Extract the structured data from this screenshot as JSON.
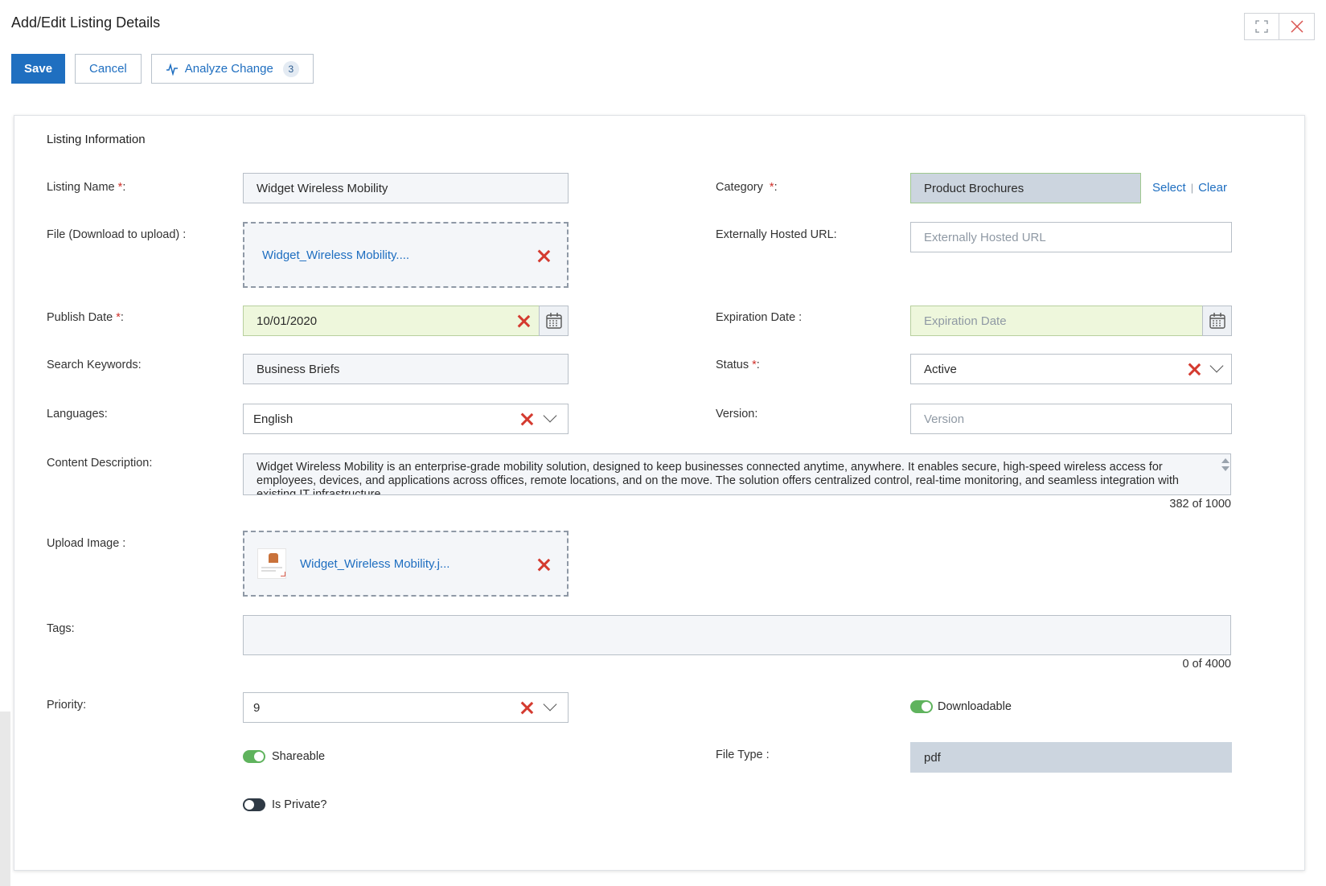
{
  "header": {
    "title": "Add/Edit Listing Details",
    "save_label": "Save",
    "cancel_label": "Cancel",
    "analyze_label": "Analyze Change",
    "analyze_count": "3"
  },
  "section": {
    "title": "Listing Information"
  },
  "fields": {
    "listing_name": {
      "label": "Listing Name",
      "required": "*",
      "suffix": ":",
      "value": "Widget Wireless Mobility"
    },
    "file": {
      "label": "File (Download to upload) :",
      "value": "Widget_Wireless Mobility...."
    },
    "publish_date": {
      "label": "Publish Date",
      "required": "*",
      "suffix": ":",
      "value": "10/01/2020"
    },
    "search_keywords": {
      "label": "Search Keywords:",
      "value": "Business Briefs"
    },
    "languages": {
      "label": "Languages:",
      "value": "English"
    },
    "content_description": {
      "label": "Content Description:",
      "value": "Widget Wireless Mobility is an enterprise-grade mobility solution, designed to keep businesses connected anytime, anywhere. It enables secure, high-speed wireless access for employees, devices, and applications across offices, remote locations, and on the move. The solution offers centralized control, real-time monitoring, and seamless integration with existing IT infrastructure.",
      "counter": "382 of 1000"
    },
    "upload_image": {
      "label": "Upload Image :",
      "value": "Widget_Wireless Mobility.j..."
    },
    "tags": {
      "label": "Tags:",
      "value": "",
      "counter": "0 of 4000"
    },
    "priority": {
      "label": "Priority:",
      "value": "9"
    },
    "category": {
      "label": "Category",
      "required": "*",
      "suffix": ":",
      "value": "Product Brochures",
      "select_label": "Select",
      "sep": "|",
      "clear_label": "Clear"
    },
    "external_url": {
      "label": "Externally Hosted URL:",
      "placeholder": "Externally Hosted URL"
    },
    "expiration_date": {
      "label": "Expiration Date :",
      "placeholder": "Expiration Date"
    },
    "status": {
      "label": "Status",
      "required": "*",
      "suffix": ":",
      "value": "Active"
    },
    "version": {
      "label": "Version:",
      "placeholder": "Version"
    },
    "file_type": {
      "label": "File Type :",
      "value": "pdf"
    }
  },
  "toggles": {
    "downloadable": {
      "label": "Downloadable",
      "on": true
    },
    "shareable": {
      "label": "Shareable",
      "on": true
    },
    "is_private": {
      "label": "Is Private?",
      "on": false
    }
  },
  "colors": {
    "primary": "#1f6fc0",
    "link": "#1e6ec0",
    "danger": "#d43a2f",
    "toggle_on": "#5fb35d",
    "toggle_off": "#2f3a45",
    "date_bg": "#eef7dc"
  }
}
